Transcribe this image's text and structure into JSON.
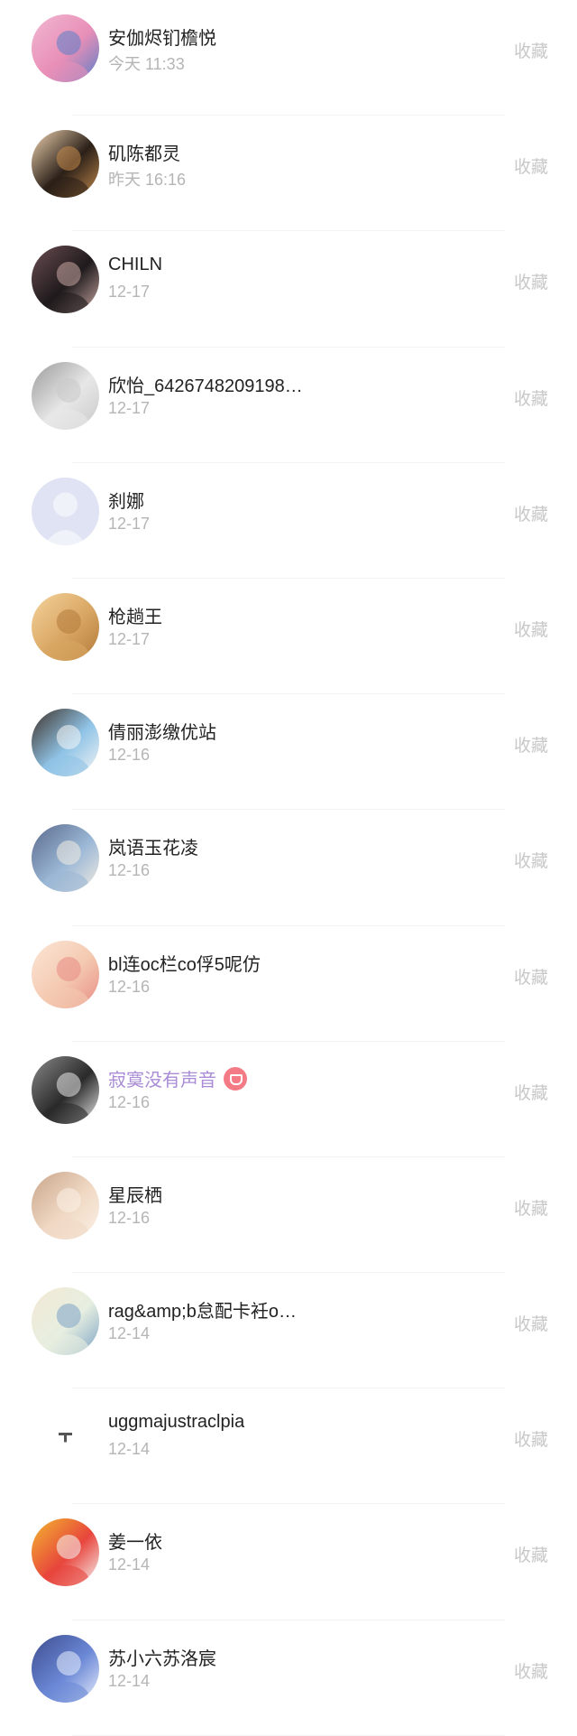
{
  "list": {
    "action_label": "收藏",
    "items": [
      {
        "name": "安伽烬钔檐悦",
        "date": "今天 11:33",
        "avatar": "avatar-sky-art",
        "colors": [
          "#e88fb7",
          "#5a7fc8",
          "#f1b7d1"
        ]
      },
      {
        "name": "矶陈都灵",
        "date": "昨天 16:16",
        "avatar": "avatar-man-portrait",
        "colors": [
          "#2b2018",
          "#c48b4d",
          "#f0d3b0"
        ]
      },
      {
        "name": "CHILN",
        "date": "12-17",
        "avatar": "avatar-dark-girl",
        "colors": [
          "#1f1a1c",
          "#c9a8a3",
          "#6b4d52"
        ]
      },
      {
        "name": "欣怡_6426748209198…",
        "date": "12-17",
        "avatar": "avatar-sketch",
        "colors": [
          "#e7e7e7",
          "#c9c9c9",
          "#9b9b9b"
        ]
      },
      {
        "name": "刹娜",
        "date": "12-17",
        "avatar": "avatar-default-user",
        "colors": [
          "#dfe3f3",
          "#f0f2fa",
          "#ffffff"
        ]
      },
      {
        "name": "枪趟王",
        "date": "12-17",
        "avatar": "avatar-food",
        "colors": [
          "#d9a663",
          "#b37a3a",
          "#f4d39c"
        ]
      },
      {
        "name": "倩丽澎缴优站",
        "date": "12-16",
        "avatar": "avatar-beach-boy",
        "colors": [
          "#8fc3e6",
          "#f5f5f5",
          "#3d3026"
        ]
      },
      {
        "name": "岚语玉花凌",
        "date": "12-16",
        "avatar": "avatar-anime-winter",
        "colors": [
          "#9bb7d6",
          "#f2ece1",
          "#5a6a8c"
        ]
      },
      {
        "name": "bl连oc栏co俘5呢仿",
        "date": "12-16",
        "avatar": "avatar-cute-sheep",
        "colors": [
          "#f4c9b0",
          "#e88b84",
          "#fbe6d6"
        ]
      },
      {
        "name": "寂寞没有声音",
        "date": "12-16",
        "avatar": "avatar-manga-girl",
        "colors": [
          "#2a2a2a",
          "#e9e9e9",
          "#8a8a8a"
        ],
        "vip": true
      },
      {
        "name": "星辰栖",
        "date": "12-16",
        "avatar": "avatar-pastel-girl",
        "colors": [
          "#f0d9c4",
          "#fbf1e6",
          "#c9a58a"
        ]
      },
      {
        "name": "rag&amp;b怠配卡衽o…",
        "date": "12-14",
        "avatar": "avatar-couple",
        "colors": [
          "#e7efe0",
          "#7ea3c7",
          "#f3e8d5"
        ]
      },
      {
        "name": "uggmajustraclpia",
        "date": "12-14",
        "avatar": "avatar-blank-t",
        "colors": [
          "#ffffff",
          "#555555",
          "#ffffff"
        ]
      },
      {
        "name": "姜一依",
        "date": "12-14",
        "avatar": "avatar-red-bird",
        "colors": [
          "#e8453c",
          "#f6f6f6",
          "#f2b72e"
        ]
      },
      {
        "name": "苏小六苏洛宸",
        "date": "12-14",
        "avatar": "avatar-blue-hair",
        "colors": [
          "#6b88d6",
          "#e8eefb",
          "#3d4d8f"
        ]
      }
    ]
  }
}
